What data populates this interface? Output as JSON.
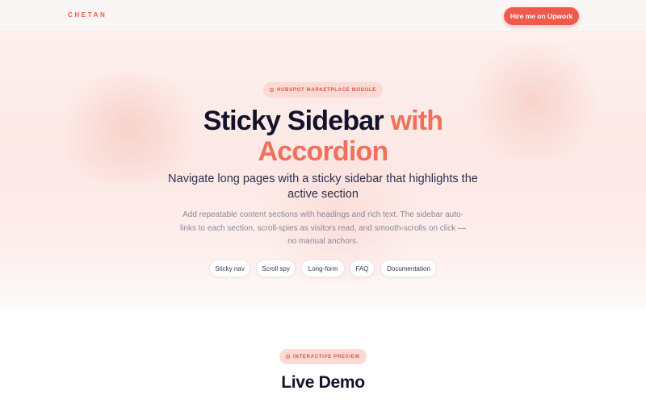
{
  "header": {
    "brand": "CHETAN",
    "hire_label": "Hire me on Upwork"
  },
  "hero": {
    "badge": "HUBSPOT MARKETPLACE MODULE",
    "title_main": "Sticky Sidebar ",
    "title_accent_1": "with",
    "title_accent_2": "Accordion",
    "subtitle": "Navigate long pages with a sticky sidebar that highlights the active section",
    "description": "Add repeatable content sections with headings and rich text. The sidebar auto-links to each section, scroll-spies as visitors read, and smooth-scrolls on click — no manual anchors.",
    "tags": [
      "Sticky nav",
      "Scroll spy",
      "Long-form",
      "FAQ",
      "Documentation"
    ]
  },
  "demo": {
    "badge": "INTERACTIVE PREVIEW",
    "title": "Live Demo"
  },
  "colors": {
    "accent": "#ef5a4c",
    "accent_light": "#f0705b",
    "title": "#12122a",
    "badge_bg": "#fbd9d4"
  }
}
